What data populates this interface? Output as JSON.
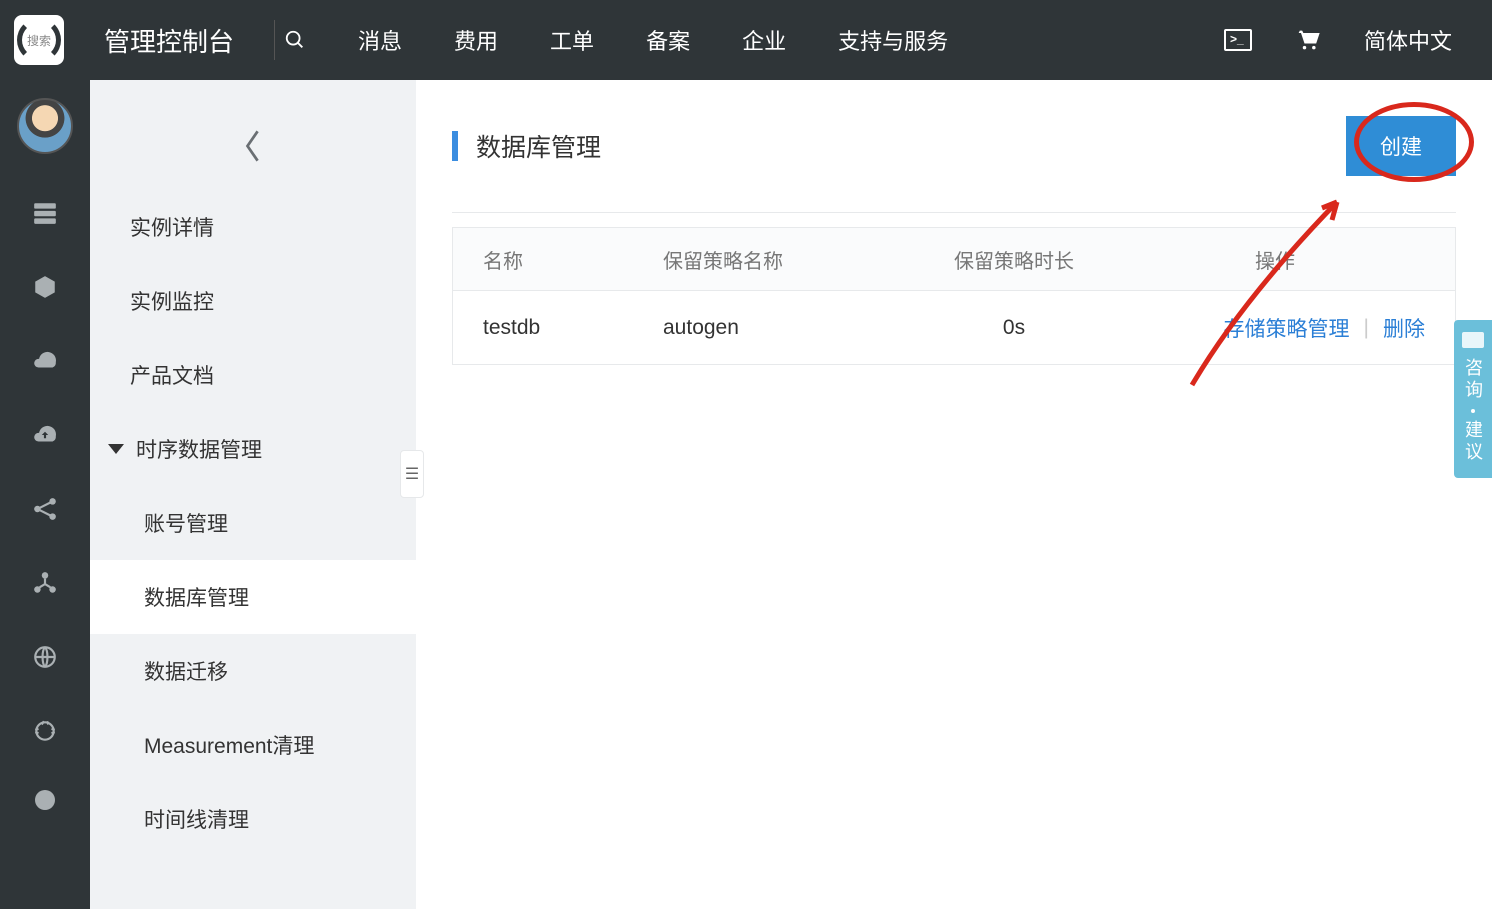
{
  "header": {
    "logo_text": "搜索",
    "console_label": "管理控制台",
    "nav": {
      "message": "消息",
      "billing": "费用",
      "ticket": "工单",
      "filing": "备案",
      "enterprise": "企业",
      "support": "支持与服务"
    },
    "language": "简体中文"
  },
  "menu": {
    "items": {
      "instance_detail": "实例详情",
      "instance_monitor": "实例监控",
      "docs": "产品文档",
      "tsdm": "时序数据管理",
      "sub": {
        "account": "账号管理",
        "database": "数据库管理",
        "migration": "数据迁移",
        "measurement_clean": "Measurement清理",
        "timeline_clean": "时间线清理"
      }
    }
  },
  "page": {
    "title": "数据库管理",
    "create_button": "创建",
    "table": {
      "headers": {
        "name": "名称",
        "policy_name": "保留策略名称",
        "policy_duration": "保留策略时长",
        "ops": "操作"
      },
      "row": {
        "name": "testdb",
        "policy": "autogen",
        "duration": "0s",
        "storage_policy": "存储策略管理",
        "delete": "删除"
      }
    }
  },
  "feedback": {
    "line1": "咨询",
    "line2": "建议"
  }
}
